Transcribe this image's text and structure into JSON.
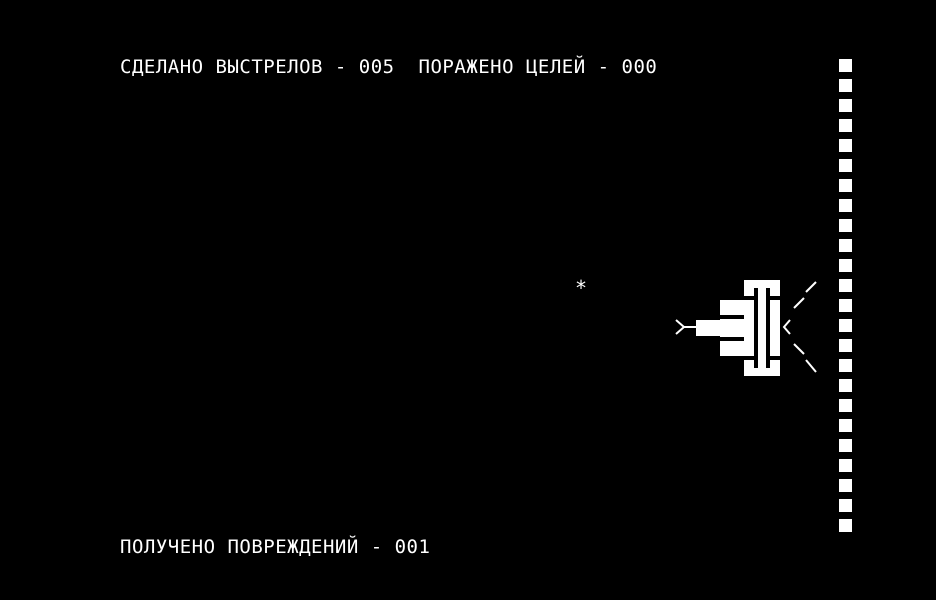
{
  "hud": {
    "shots_label": "СДЕЛАНО ВЫСТРЕЛОВ",
    "shots_value": "005",
    "hits_label": "ПОРАЖЕНО ЦЕЛЕЙ",
    "hits_value": "000",
    "damage_label": "ПОЛУЧЕНО ПОВРЕЖДЕНИЙ",
    "damage_value": "001",
    "separator": " - "
  },
  "playfield": {
    "star_glyph": "*",
    "wall_blocks": 24
  },
  "colors": {
    "background": "#000000",
    "foreground": "#ffffff"
  },
  "icons": {
    "ship": "player-ship-icon",
    "star": "projectile-icon",
    "wall": "wall-block-icon"
  }
}
